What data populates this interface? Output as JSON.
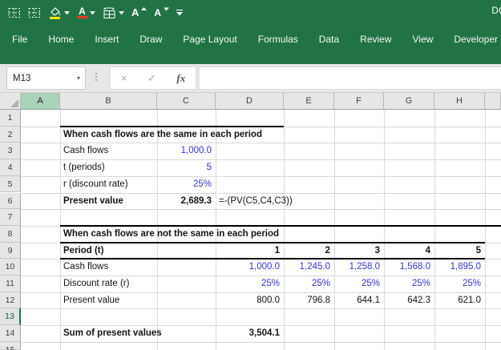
{
  "app": {
    "account_badge": "DC"
  },
  "colors": {
    "ribbon_green": "#217346",
    "input_blue": "#3333CC",
    "selected_column_fill": "#A9D2B9",
    "highlight_yellow": "#F7E600",
    "font_red": "#E03A2B",
    "header_gray": "#E6E6E6",
    "gridline_gray": "#D9D9D9"
  },
  "qat": {
    "icons": [
      "borders-dotted-icon",
      "borders-dotted-alt-icon",
      "fill-color-icon",
      "font-color-icon",
      "borders-grid-icon",
      "grow-font-icon",
      "shrink-font-icon",
      "customize-qat-icon"
    ],
    "font_glyph": "A"
  },
  "ribbon": {
    "tabs": [
      "File",
      "Home",
      "Insert",
      "Draw",
      "Page Layout",
      "Formulas",
      "Data",
      "Review",
      "View",
      "Developer"
    ]
  },
  "formula_bar": {
    "name_box": "M13",
    "value": "",
    "buttons": [
      {
        "name": "cancel-button",
        "glyph": "×"
      },
      {
        "name": "enter-button",
        "glyph": "✓"
      },
      {
        "name": "insert-function-button",
        "glyph": "fx"
      }
    ]
  },
  "sheet": {
    "selected_cell": "M13",
    "columns": [
      "A",
      "B",
      "C",
      "D",
      "E",
      "F",
      "G",
      "H"
    ],
    "row_count": 15,
    "selected_column_header": "A",
    "selected_row_header": 13,
    "cells": [
      {
        "ref": "B2",
        "text": "When cash flows are the same in each period",
        "align": "left",
        "bold": true,
        "color": "black"
      },
      {
        "ref": "B3",
        "text": "Cash flows",
        "align": "left",
        "bold": false,
        "color": "black"
      },
      {
        "ref": "C3",
        "text": "1,000.0",
        "align": "right",
        "bold": false,
        "color": "blue"
      },
      {
        "ref": "B4",
        "text": "t (periods)",
        "align": "left",
        "bold": false,
        "color": "black"
      },
      {
        "ref": "C4",
        "text": "5",
        "align": "right",
        "bold": false,
        "color": "blue"
      },
      {
        "ref": "B5",
        "text": "r (discount rate)",
        "align": "left",
        "bold": false,
        "color": "black"
      },
      {
        "ref": "C5",
        "text": "25%",
        "align": "right",
        "bold": false,
        "color": "blue"
      },
      {
        "ref": "B6",
        "text": "Present value",
        "align": "left",
        "bold": true,
        "color": "black"
      },
      {
        "ref": "C6",
        "text": "2,689.3",
        "align": "right",
        "bold": true,
        "color": "black"
      },
      {
        "ref": "D6",
        "text": "=-(PV(C5,C4,C3))",
        "align": "left",
        "bold": false,
        "color": "black"
      },
      {
        "ref": "B8",
        "text": "When cash flows are not the same in each period",
        "align": "left",
        "bold": true,
        "color": "black"
      },
      {
        "ref": "B9",
        "text": "Period (t)",
        "align": "left",
        "bold": true,
        "color": "black"
      },
      {
        "ref": "D9",
        "text": "1",
        "align": "right",
        "bold": true,
        "color": "black"
      },
      {
        "ref": "E9",
        "text": "2",
        "align": "right",
        "bold": true,
        "color": "black"
      },
      {
        "ref": "F9",
        "text": "3",
        "align": "right",
        "bold": true,
        "color": "black"
      },
      {
        "ref": "G9",
        "text": "4",
        "align": "right",
        "bold": true,
        "color": "black"
      },
      {
        "ref": "H9",
        "text": "5",
        "align": "right",
        "bold": true,
        "color": "black"
      },
      {
        "ref": "B10",
        "text": "Cash flows",
        "align": "left",
        "bold": false,
        "color": "black"
      },
      {
        "ref": "D10",
        "text": "1,000.0",
        "align": "right",
        "bold": false,
        "color": "blue"
      },
      {
        "ref": "E10",
        "text": "1,245.0",
        "align": "right",
        "bold": false,
        "color": "blue"
      },
      {
        "ref": "F10",
        "text": "1,258.0",
        "align": "right",
        "bold": false,
        "color": "blue"
      },
      {
        "ref": "G10",
        "text": "1,568.0",
        "align": "right",
        "bold": false,
        "color": "blue"
      },
      {
        "ref": "H10",
        "text": "1,895.0",
        "align": "right",
        "bold": false,
        "color": "blue"
      },
      {
        "ref": "B11",
        "text": "Discount rate (r)",
        "align": "left",
        "bold": false,
        "color": "black"
      },
      {
        "ref": "D11",
        "text": "25%",
        "align": "right",
        "bold": false,
        "color": "blue"
      },
      {
        "ref": "E11",
        "text": "25%",
        "align": "right",
        "bold": false,
        "color": "blue"
      },
      {
        "ref": "F11",
        "text": "25%",
        "align": "right",
        "bold": false,
        "color": "blue"
      },
      {
        "ref": "G11",
        "text": "25%",
        "align": "right",
        "bold": false,
        "color": "blue"
      },
      {
        "ref": "H11",
        "text": "25%",
        "align": "right",
        "bold": false,
        "color": "blue"
      },
      {
        "ref": "B12",
        "text": "Present value",
        "align": "left",
        "bold": false,
        "color": "black"
      },
      {
        "ref": "D12",
        "text": "800.0",
        "align": "right",
        "bold": false,
        "color": "black"
      },
      {
        "ref": "E12",
        "text": "796.8",
        "align": "right",
        "bold": false,
        "color": "black"
      },
      {
        "ref": "F12",
        "text": "644.1",
        "align": "right",
        "bold": false,
        "color": "black"
      },
      {
        "ref": "G12",
        "text": "642.3",
        "align": "right",
        "bold": false,
        "color": "black"
      },
      {
        "ref": "H12",
        "text": "621.0",
        "align": "right",
        "bold": false,
        "color": "black"
      },
      {
        "ref": "B14",
        "text": "Sum of present values",
        "align": "left",
        "bold": true,
        "color": "black"
      },
      {
        "ref": "D14",
        "text": "3,504.1",
        "align": "right",
        "bold": true,
        "color": "black"
      }
    ],
    "borders": [
      {
        "row_boundary": 1,
        "from_col": "B",
        "to_col": "D"
      },
      {
        "row_boundary": 7,
        "from_col": "B",
        "to_col": "EDGE"
      },
      {
        "row_boundary": 8,
        "from_col": "B",
        "to_col": "H"
      },
      {
        "row_boundary": 9,
        "from_col": "B",
        "to_col": "H"
      }
    ]
  }
}
